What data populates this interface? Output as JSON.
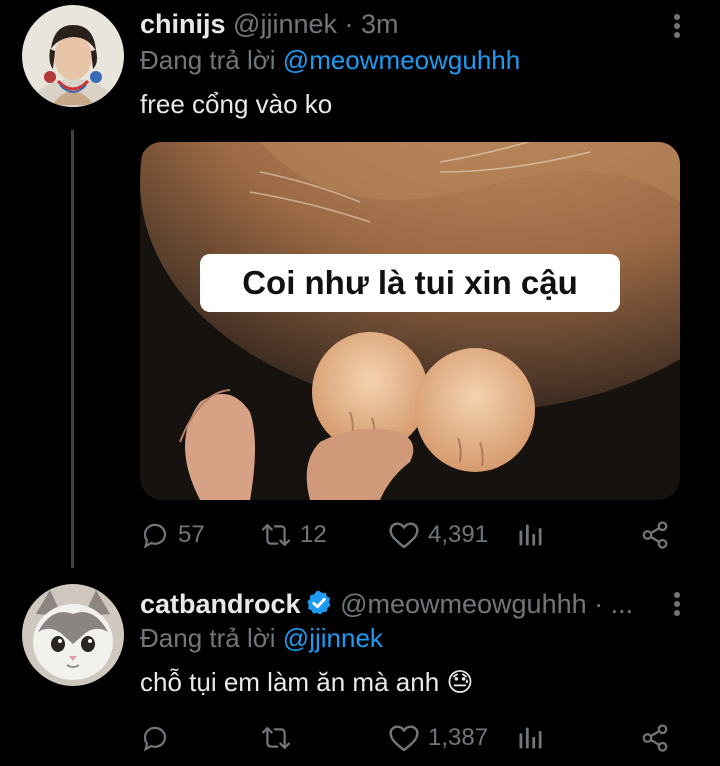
{
  "tweets": [
    {
      "display_name": "chinijs",
      "handle": "@jjinnek",
      "separator": "·",
      "time": "3m",
      "replying_prefix": "Đang trả lời",
      "replying_to": "@meowmeowguhhh",
      "text": "free cổng vào ko",
      "image_caption": "Coi như là tui xin cậu",
      "stats": {
        "replies": "57",
        "retweets": "12",
        "likes": "4,391"
      }
    },
    {
      "display_name": "catbandrock",
      "verified": true,
      "handle": "@meowmeowguhhh",
      "separator": "·",
      "time": "...",
      "replying_prefix": "Đang trả lời",
      "replying_to": "@jjinnek",
      "text": "chỗ tụi em làm ăn mà anh",
      "emoji": "😓",
      "stats": {
        "replies": "",
        "retweets": "",
        "likes": "1,387"
      }
    }
  ],
  "icons": {
    "reply": "reply-icon",
    "retweet": "retweet-icon",
    "like": "heart-icon",
    "views": "analytics-icon",
    "share": "share-icon",
    "more": "more-vertical-icon",
    "verified": "verified-badge-icon"
  },
  "colors": {
    "background": "#000000",
    "text": "#e7e9ea",
    "muted": "#71767b",
    "link": "#1d9bf0",
    "verified": "#1d9bf0"
  }
}
